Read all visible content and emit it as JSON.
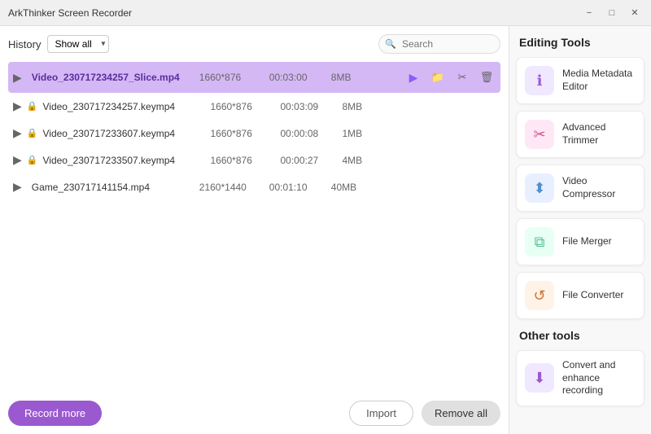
{
  "app": {
    "title": "ArkThinker Screen Recorder"
  },
  "titlebar": {
    "minimize_label": "−",
    "maximize_label": "□",
    "close_label": "✕"
  },
  "toolbar": {
    "history_label": "History",
    "show_all_label": "Show all",
    "search_placeholder": "Search"
  },
  "files": [
    {
      "name": "Video_230717234257_Slice.mp4",
      "resolution": "1660*876",
      "duration": "00:03:00",
      "size": "8MB",
      "locked": false,
      "selected": true
    },
    {
      "name": "Video_230717234257.keymp4",
      "resolution": "1660*876",
      "duration": "00:03:09",
      "size": "8MB",
      "locked": true,
      "selected": false
    },
    {
      "name": "Video_230717233607.keymp4",
      "resolution": "1660*876",
      "duration": "00:00:08",
      "size": "1MB",
      "locked": true,
      "selected": false
    },
    {
      "name": "Video_230717233507.keymp4",
      "resolution": "1660*876",
      "duration": "00:00:27",
      "size": "4MB",
      "locked": true,
      "selected": false
    },
    {
      "name": "Game_230717141154.mp4",
      "resolution": "2160*1440",
      "duration": "00:01:10",
      "size": "40MB",
      "locked": false,
      "selected": false
    }
  ],
  "buttons": {
    "record_more": "Record more",
    "import": "Import",
    "remove_all": "Remove all"
  },
  "editing_tools": {
    "section_title": "Editing Tools",
    "tools": [
      {
        "id": "media-metadata",
        "name": "Media Metadata Editor",
        "icon_type": "purple",
        "icon": "ℹ"
      },
      {
        "id": "advanced-trimmer",
        "name": "Advanced Trimmer",
        "icon_type": "pink",
        "icon": "✂"
      },
      {
        "id": "video-compressor",
        "name": "Video Compressor",
        "icon_type": "blue",
        "icon": "⬍"
      },
      {
        "id": "file-merger",
        "name": "File Merger",
        "icon_type": "teal",
        "icon": "⧉"
      },
      {
        "id": "file-converter",
        "name": "File Converter",
        "icon_type": "orange",
        "icon": "↺"
      }
    ]
  },
  "other_tools": {
    "section_title": "Other tools",
    "tools": [
      {
        "id": "convert-enhance",
        "name": "Convert and enhance recording",
        "icon_type": "purple",
        "icon": "⬇"
      }
    ]
  }
}
